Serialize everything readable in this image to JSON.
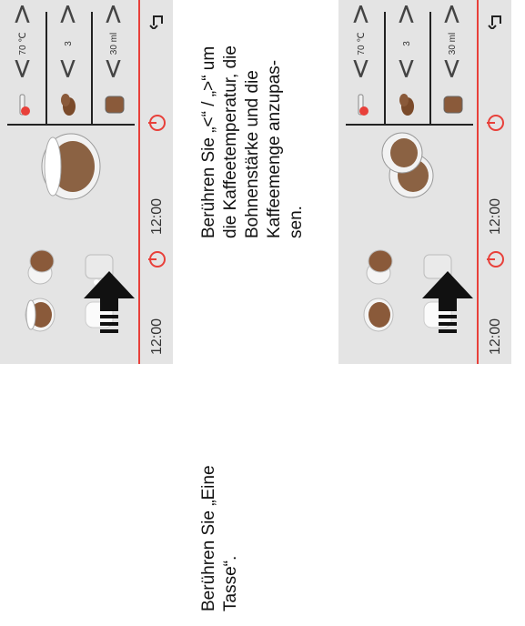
{
  "panels": {
    "time": "12:00"
  },
  "captions": {
    "step1": [
      "Berühren Sie „Eine",
      "Tasse“."
    ],
    "step2": [
      "Berühren Sie „<“ / „>“ um",
      "die Kaffeetemperatur, die",
      "Bohnenstärke und die",
      "Kaffeemenge anzupas-",
      "sen."
    ]
  },
  "settings": {
    "temperature": "70 ℃",
    "strength": "3",
    "amount": "30 ml"
  },
  "colors": {
    "accent": "#e8403a",
    "screen": "#e4e4e4"
  },
  "icons": [
    "power-icon",
    "gear-icon",
    "back-icon",
    "chevron-up-icon",
    "chevron-down-icon",
    "arrow-up-icon",
    "thermometer-icon",
    "coffee-bean-icon",
    "cup-icon"
  ]
}
